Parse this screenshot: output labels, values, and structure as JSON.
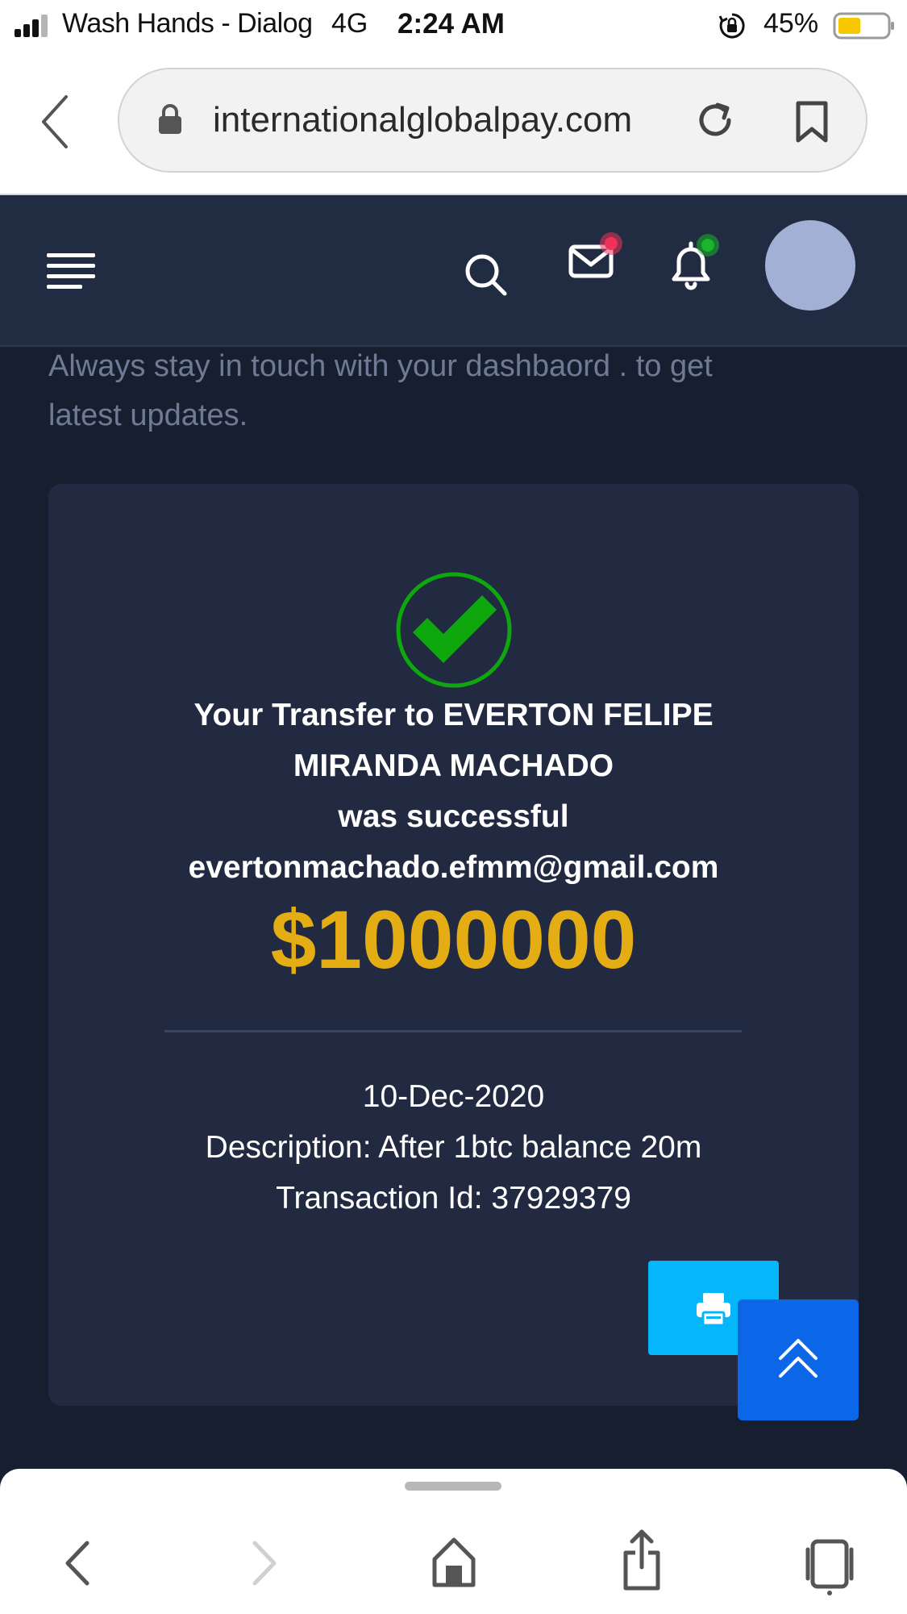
{
  "status_bar": {
    "carrier": "Wash Hands - Dialog",
    "network": "4G",
    "time": "2:24 AM",
    "battery_percent": "45%"
  },
  "browser": {
    "url": "internationalglobalpay.com"
  },
  "app_header": {
    "icons": [
      "menu-icon",
      "search-icon",
      "mail-icon",
      "bell-icon"
    ],
    "mail_badge_color": "#f0325a",
    "bell_badge_color": "#19b52a"
  },
  "intro": {
    "line1": "Always stay in touch with your dashbaord . to get",
    "line2": "latest updates."
  },
  "receipt": {
    "title_line1": "Your Transfer to EVERTON FELIPE",
    "title_line2": "MIRANDA MACHADO",
    "status": "was successful",
    "email": "evertonmachado.efmm@gmail.com",
    "amount": "$1000000",
    "date": "10-Dec-2020",
    "description": "Description: After 1btc balance 20m",
    "transaction_id": "Transaction Id: 37929379"
  },
  "colors": {
    "page_bg": "#171e2f",
    "card_bg": "#212a40",
    "header_bg": "#212b42",
    "amount": "#e5ad14",
    "success_green": "#0ea80e",
    "print_button": "#05b6fb",
    "scroll_top_button": "#0b67e8"
  }
}
